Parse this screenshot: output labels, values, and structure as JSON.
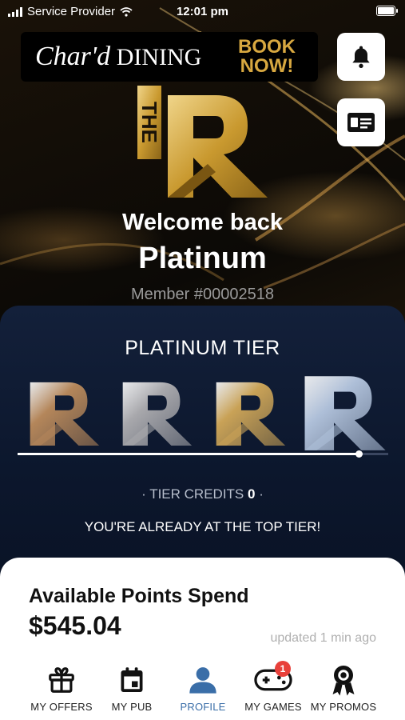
{
  "status_bar": {
    "carrier": "Service Provider",
    "time": "12:01 pm"
  },
  "banner": {
    "brand_script": "Char'd",
    "brand_word": "DINING",
    "cta_line1": "BOOK",
    "cta_line2": "NOW!"
  },
  "header_icons": [
    "bell-icon",
    "member-card-icon"
  ],
  "logo": {
    "the": "THE",
    "letter": "R"
  },
  "welcome": {
    "greeting": "Welcome back",
    "name": "Platinum",
    "member_number": "Member #00002518"
  },
  "tier": {
    "title": "PLATINUM TIER",
    "tiers": [
      {
        "name": "bronze",
        "color": "#b4865a"
      },
      {
        "name": "silver",
        "color": "#a8a8ac"
      },
      {
        "name": "gold",
        "color": "#c9a257"
      },
      {
        "name": "platinum",
        "color": "#aebfd8"
      }
    ],
    "progress": 0.92,
    "credits_label": "· TIER CREDITS",
    "credits_value": "0",
    "credits_suffix": "·",
    "message": "YOU'RE ALREADY AT THE TOP TIER!"
  },
  "points": {
    "label": "Available Points Spend",
    "value": "$545.04",
    "updated": "updated 1 min ago"
  },
  "nav": [
    {
      "label": "MY OFFERS",
      "icon": "gift-icon",
      "active": false
    },
    {
      "label": "MY PUB",
      "icon": "calendar-icon",
      "active": false
    },
    {
      "label": "PROFILE",
      "icon": "person-icon",
      "active": true
    },
    {
      "label": "MY GAMES",
      "icon": "gamepad-icon",
      "active": false,
      "badge": "1"
    },
    {
      "label": "MY PROMOS",
      "icon": "award-icon",
      "active": false
    }
  ],
  "colors": {
    "gold": "#d8a840",
    "navy": "#0c172d",
    "active_blue": "#3a6ea8",
    "badge_red": "#e8403a"
  }
}
